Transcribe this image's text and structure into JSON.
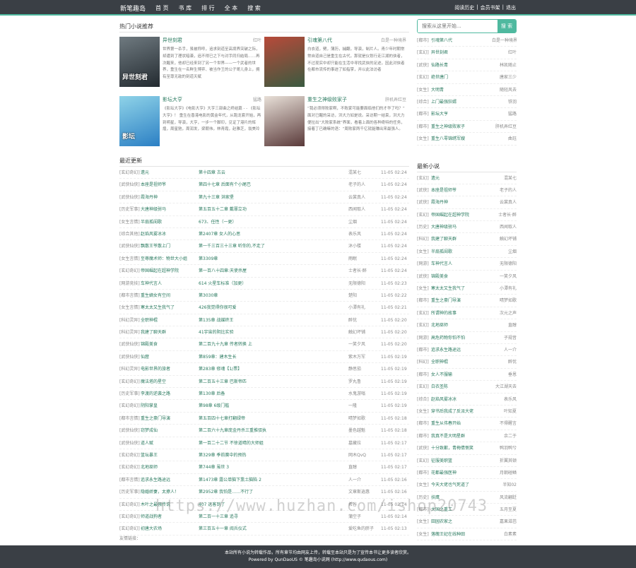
{
  "header": {
    "logo": "新笔趣岛",
    "nav": [
      "首 页",
      "书 库",
      "排 行",
      "全 本",
      "搜 索"
    ],
    "links": [
      "阅读历史",
      "|",
      "会员书架",
      "|",
      "退出"
    ]
  },
  "hot": {
    "title": "热门小说推荐",
    "items": [
      {
        "name": "异世刻君",
        "author": "红叶",
        "desc": "世界第一杀手，虽被称呼，追求刻道至高境界突破之际，却遭到了理状暗袭，追不得已之下与对手同归结局……再次醒来，他却已经来到了另一个世界——一个武者的世界，重生在一名鲜生博弈、被当作王的公子哥儿身上，拥有至尊无敌的刻道天赋",
        "cover_text": "异世刻君",
        "cover_colors": [
          "#6f7a80",
          "#232a30"
        ]
      },
      {
        "name": "引魂第八代",
        "author": "白是一种境界",
        "desc": "白衣道，劈，薄历，捕翻，导演，制片人。青少年时期常常自道自己是重生在古代，那就是仪划行走江湖的侠者，不过现实中却只能在生活中寻找武侠的足迹，因此对侠者在都市流传的事迹了如指掌，并以此法访者",
        "cover_text": "",
        "cover_colors": [
          "#b84a3a",
          "#3a5a40"
        ]
      },
      {
        "name": "影坛大亨",
        "author": "猛路",
        "desc": "《影坛大亨》《电影大亨》大亨三部曲之终结篇 - - 《影坛大亨》！ 重生在香港电影的黄金年代，从跑龙套开始，再到明星，导演，大亨，一步一个脚印，见证了港片的辉煌，周星驰，周润发，梁朝伟，林青霞，赵雅芝，翁美玲",
        "cover_text": "影坛",
        "cover_colors": [
          "#8fd3e8",
          "#2b7fc4"
        ]
      },
      {
        "name": "重生之神级败家子",
        "author": "肝机弄红豆",
        "desc": "“我必须得败家啊，不败家可能要面临他们的才华了吗？” 面对已醒的采访，洪大力如是说。采访期一结束，洪大力便拉出“大败家系统”界面，看着上面的各种奇特的任务，接着丁已确嘛的语：“周败家两千亿就能赚出来最强人。",
        "cover_text": "",
        "cover_colors": [
          "#e8e0d8",
          "#5a3a3a"
        ]
      }
    ]
  },
  "recent": {
    "title": "最近更新",
    "rows": [
      {
        "cat": "[玄幻奇幻]",
        "name": "遗元",
        "chap": "第十四章 古云",
        "author": "混某七",
        "time": "11-05 02:24"
      },
      {
        "cat": "[武侠仙侠]",
        "name": "本座是祖师爷",
        "chap": "第四十七章 后面有个小尾巴",
        "author": "老子的人",
        "time": "11-05 02:24"
      },
      {
        "cat": "[武侠仙侠]",
        "name": "霞海丹神",
        "chap": "第九十三章 洪家堡",
        "author": "云裳真人",
        "time": "11-05 02:24"
      },
      {
        "cat": "[历史军事]",
        "name": "大唐神级驸马",
        "chap": "第五百五十二章 戴罪立功",
        "author": "西闻取人",
        "time": "11-05 02:24"
      },
      {
        "cat": "[女生言情]",
        "name": "半扇孤闺歌",
        "chap": "673、任性（一更）",
        "author": "尘烟",
        "time": "11-05 02:24"
      },
      {
        "cat": "[综合其他]",
        "name": "赵焰风雾冰冰",
        "chap": "第2407章 女人的心思",
        "author": "表乐风",
        "time": "11-05 02:24"
      },
      {
        "cat": "[武侠仙侠]",
        "name": "飘散王爷散上门",
        "chap": "第一千三百三十三章 听你的,不走了",
        "author": "沐小楼",
        "time": "11-05 02:24"
      },
      {
        "cat": "[女生言情]",
        "name": "至尊魔术师：物世大小姐",
        "chap": "第3309章",
        "author": "雨眠",
        "time": "11-05 02:24"
      },
      {
        "cat": "[玄幻奇幻]",
        "name": "帝国崛起在超神学院",
        "chap": "第一百八十四章:天使杀屋",
        "author": "士者长·醉",
        "time": "11-05 02:24"
      },
      {
        "cat": "[网游竞技]",
        "name": "车神代言人",
        "chap": "614 火星车标准（加更）",
        "author": "无限德阳",
        "time": "11-05 02:23"
      },
      {
        "cat": "[都市言情]",
        "name": "重生嫡女有空间",
        "chap": "第3030章",
        "author": "楚阳",
        "time": "11-05 02:22"
      },
      {
        "cat": "[女生言情]",
        "name": "寒太太又生我气了",
        "chap": "426我觉得你很可爱",
        "author": "小潭有礼",
        "time": "11-05 02:21"
      },
      {
        "cat": "[科幻灵异]",
        "name": "全职神棍",
        "chap": "第135章 战媒终王",
        "author": "醉忧",
        "time": "11-05 02:20"
      },
      {
        "cat": "[科幻灵异]",
        "name": "我建了聊天群",
        "chap": "41宇宙的阴比实验",
        "author": "触幻坏铺",
        "time": "11-05 02:20"
      },
      {
        "cat": "[武侠仙侠]",
        "name": "锦殿美食",
        "chap": "第二百九十九章 传者转换 上",
        "author": "一笑夕风",
        "time": "11-05 02:20"
      },
      {
        "cat": "[武侠仙侠]",
        "name": "仙窟",
        "chap": "第859章：建木生长",
        "author": "紫木万军",
        "time": "11-05 02:19"
      },
      {
        "cat": "[科幻灵异]",
        "name": "电影世界的旅者",
        "chap": "第283章 修魂【1/票】",
        "author": "静思茄",
        "time": "11-05 02:19"
      },
      {
        "cat": "[玄幻奇幻]",
        "name": "魔法塔的星空",
        "chap": "第二百五十三章 巴斯帝匹",
        "author": "罗丸鲁",
        "time": "11-05 02:19"
      },
      {
        "cat": "[历史军事]",
        "name": "李渡的逆袭之路",
        "chap": "第130章 后备",
        "author": "水鬼游嗡",
        "time": "11-05 02:19"
      },
      {
        "cat": "[玄幻奇幻]",
        "name": "阴阳掌皇",
        "chap": "第98章 6级门槛",
        "author": "一隆",
        "time": "11-05 02:19"
      },
      {
        "cat": "[都市言情]",
        "name": "重生之豪门导演",
        "chap": "第五百四十七章打翻绿帝",
        "author": "晴梦如歌",
        "time": "11-05 02:18"
      },
      {
        "cat": "[武侠仙侠]",
        "name": "窃梦成仙",
        "chap": "第二百六十九章庞金丹杀三重推驭执",
        "author": "墨色越魁",
        "time": "11-05 02:18"
      },
      {
        "cat": "[武侠仙侠]",
        "name": "道人赋",
        "chap": "第一百二十二节 不徐道晴的大师姐",
        "author": "墓藏拉",
        "time": "11-05 02:17"
      },
      {
        "cat": "[玄幻奇幻]",
        "name": "篮坛暴王",
        "chap": "第329章 季前赛中的预热",
        "author": "网木QvQ",
        "time": "11-05 02:17"
      },
      {
        "cat": "[玄幻奇幻]",
        "name": "北地巫师",
        "chap": "第744章 虽世 3",
        "author": "直醇",
        "time": "11-05 02:17"
      },
      {
        "cat": "[都市言情]",
        "name": "追求永生路途远",
        "chap": "第1473章 露公单脑下熏土脑陷 2",
        "author": "人一介",
        "time": "11-05 02:16"
      },
      {
        "cat": "[历史军事]",
        "name": "隐婚娇妻，太撩人！",
        "chap": "第2952章 我怕是……不行了",
        "author": "文章斯逍惠",
        "time": "11-05 02:16"
      },
      {
        "cat": "[玄幻奇幻]",
        "name": "木叶之最强传说",
        "chap": "407 远客到了",
        "author": "希谷",
        "time": "11-05 02:14"
      },
      {
        "cat": "[玄幻奇幻]",
        "name": "师道战狗者",
        "chap": "第二百一十三章 追寻",
        "author": "蒲空子",
        "time": "11-05 02:14"
      },
      {
        "cat": "[玄幻奇幻]",
        "name": "初唐大农场",
        "chap": "第三百五十一章 阅兵仪式",
        "author": "爱吃鱼的胖子",
        "time": "11-05 02:13"
      }
    ]
  },
  "search": {
    "placeholder": "搜索从这里开始...",
    "button": "搜 索"
  },
  "side_hot": [
    {
      "cat": "[都市]",
      "name": "引魂第八代",
      "author": "白是一种境界"
    },
    {
      "cat": "[玄幻]",
      "name": "异世刻君",
      "author": "红叶"
    },
    {
      "cat": "[武侠]",
      "name": "仙路长青",
      "author": "林凯随止"
    },
    {
      "cat": "[玄幻]",
      "name": "绝世唐门",
      "author": "唐家三少"
    },
    {
      "cat": "[女生]",
      "name": "大明青",
      "author": "随轻风去"
    },
    {
      "cat": "[综合]",
      "name": "上门最强狂婿",
      "author": "铁羽"
    },
    {
      "cat": "[都市]",
      "name": "影坛大亨",
      "author": "猛路"
    },
    {
      "cat": "[都市]",
      "name": "重生之神级败家子",
      "author": "肝机弄红豆"
    },
    {
      "cat": "[女生]",
      "name": "重生八零锦绣军嫂",
      "author": "曲珏"
    }
  ],
  "newest": {
    "title": "最新小说",
    "rows": [
      {
        "cat": "[玄幻]",
        "name": "遗元",
        "author": "混某七"
      },
      {
        "cat": "[武侠]",
        "name": "本座是祖师爷",
        "author": "老子的人"
      },
      {
        "cat": "[武侠]",
        "name": "霞海丹神",
        "author": "云裳真人"
      },
      {
        "cat": "[玄幻]",
        "name": "帝国崛起在超神学院",
        "author": "士者长·醉"
      },
      {
        "cat": "[历史]",
        "name": "大唐神级驸马",
        "author": "西闻取人"
      },
      {
        "cat": "[科幻]",
        "name": "我建了聊天群",
        "author": "触幻坏铺"
      },
      {
        "cat": "[女生]",
        "name": "半扇孤闺歌",
        "author": "尘烟"
      },
      {
        "cat": "[网游]",
        "name": "车神代言人",
        "author": "无限德阳"
      },
      {
        "cat": "[武侠]",
        "name": "锦殿美食",
        "author": "一笑夕风"
      },
      {
        "cat": "[女生]",
        "name": "寒太太又生我气了",
        "author": "小潭有礼"
      },
      {
        "cat": "[都市]",
        "name": "重生之豪门导演",
        "author": "晴梦如歌"
      },
      {
        "cat": "[玄幻]",
        "name": "所谓神的故事",
        "author": "次元之声"
      },
      {
        "cat": "[玄幻]",
        "name": "北地巫师",
        "author": "直醇"
      },
      {
        "cat": "[网游]",
        "name": "高危药物你怕不怕",
        "author": "子规音"
      },
      {
        "cat": "[都市]",
        "name": "追求永生路途远",
        "author": "人一介"
      },
      {
        "cat": "[科幻]",
        "name": "全职神棍",
        "author": "醉忧"
      },
      {
        "cat": "[都市]",
        "name": "女人不服输",
        "author": "垂恩"
      },
      {
        "cat": "[玄幻]",
        "name": "白衣圣陈",
        "author": "大江湖天去"
      },
      {
        "cat": "[综合]",
        "name": "赵焰风雾冰冰",
        "author": "表乐风"
      },
      {
        "cat": "[女生]",
        "name": "穿书后我成了反派大佬",
        "author": "叶知夏"
      },
      {
        "cat": "[都市]",
        "name": "重生从伟春开始",
        "author": "不得醒言"
      },
      {
        "cat": "[都市]",
        "name": "我真不是大明星群",
        "author": "余二于"
      },
      {
        "cat": "[武侠]",
        "name": "十分致歉，青梅倩恻笑",
        "author": "鸭羽鸭兮"
      },
      {
        "cat": "[玄幻]",
        "name": "征服美职篮",
        "author": "折翼其顿"
      },
      {
        "cat": "[都市]",
        "name": "花都最强医神",
        "author": "月朝碰鳞"
      },
      {
        "cat": "[女生]",
        "name": "今天大佬也气死道了",
        "author": "半知02"
      },
      {
        "cat": "[历史]",
        "name": "扶鹰",
        "author": "风流翩跹"
      },
      {
        "cat": "[都市]",
        "name": "大国之重工",
        "author": "五月至夏"
      },
      {
        "cat": "[女生]",
        "name": "田园农家之",
        "author": "嘉果滋芭"
      },
      {
        "cat": "[女生]",
        "name": "落魄王妃在线种田",
        "author": "白素素"
      }
    ]
  },
  "links_label": "友情链接：",
  "footer": {
    "line1": "本站所有小说为转载作品，所有章节均由网友上传，转载至本站只是为了宣传本书让更多读者欣赏。",
    "line2": "Powered by QunDaoUS © 笔趣岛小说网 (http://www.qudaous.com)"
  },
  "watermark": "https://www.huzhan.com/ishop20743",
  "colors": {
    "accent": "#4fb99f",
    "topbar": "#3a3f45",
    "link": "#2a7a5f"
  }
}
